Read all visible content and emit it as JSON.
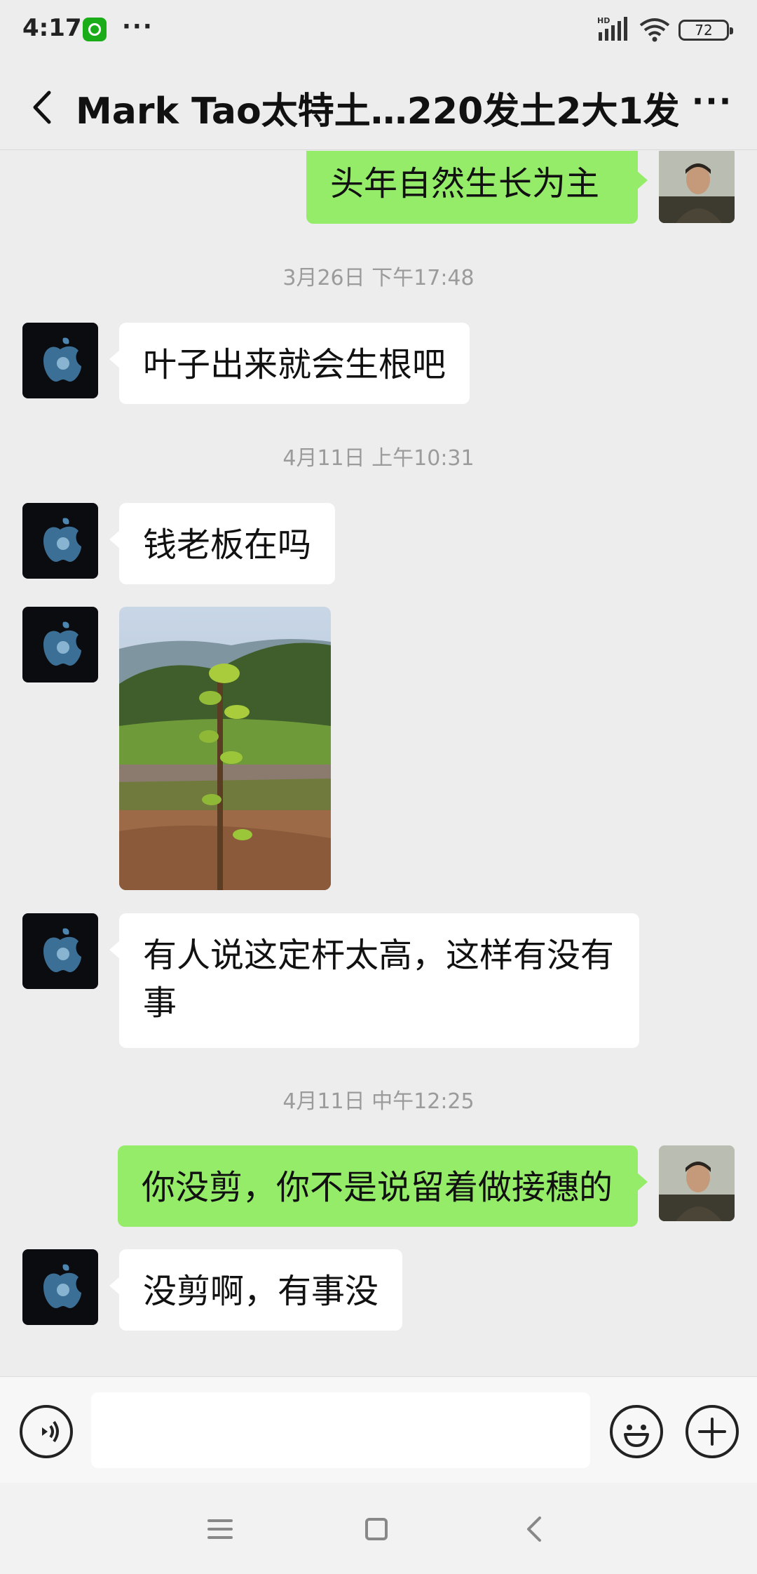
{
  "status_bar": {
    "time": "4:17",
    "more": "···",
    "network": "HD",
    "battery": "72"
  },
  "header": {
    "title": "Mark  Tao太特土…220发土2大1发",
    "more": "···",
    "back_icon": "chevron-left-icon"
  },
  "messages": [
    {
      "id": "m1",
      "side": "out",
      "type": "text",
      "text": "头年自然生长为主"
    },
    {
      "id": "t1",
      "type": "timestamp",
      "text": "3月26日 下午17:48"
    },
    {
      "id": "m2",
      "side": "in",
      "type": "text",
      "text": "叶子出来就会生根吧"
    },
    {
      "id": "t2",
      "type": "timestamp",
      "text": "4月11日 上午10:31"
    },
    {
      "id": "m3",
      "side": "in",
      "type": "text",
      "text": "钱老板在吗"
    },
    {
      "id": "m4",
      "side": "in",
      "type": "image"
    },
    {
      "id": "m5",
      "side": "in",
      "type": "text",
      "text": "有人说这定杆太高，这样有没有事"
    },
    {
      "id": "t3",
      "type": "timestamp",
      "text": "4月11日 中午12:25"
    },
    {
      "id": "m6",
      "side": "out",
      "type": "text",
      "text": "你没剪，你不是说留着做接穗的"
    },
    {
      "id": "m7",
      "side": "in",
      "type": "text",
      "text": "没剪啊，有事没"
    }
  ],
  "colors": {
    "background": "#ededed",
    "outgoing_bubble": "#95ec69",
    "incoming_bubble": "#ffffff"
  },
  "input_bar": {
    "placeholder": "",
    "voice_icon": "voice-icon",
    "emoji_icon": "emoji-icon",
    "plus_icon": "plus-icon"
  },
  "nav_bar": {
    "icons": [
      "menu-icon",
      "home-icon",
      "back-icon"
    ]
  }
}
